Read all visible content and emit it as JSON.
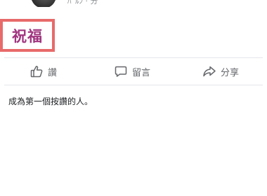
{
  "post": {
    "author_name": "ﾊﾞﾙﾝ · 分",
    "text": "祝福"
  },
  "actions": {
    "like_label": "讚",
    "comment_label": "留言",
    "share_label": "分享"
  },
  "reactions": {
    "summary": "成為第一個按讚的人。"
  },
  "icons": {
    "like": "thumbs-up-icon",
    "comment": "speech-bubble-icon",
    "share": "share-arrow-icon"
  },
  "colors": {
    "post_text": "#a0347f",
    "highlight_border": "#e86a6a",
    "action_text": "#65676b"
  }
}
